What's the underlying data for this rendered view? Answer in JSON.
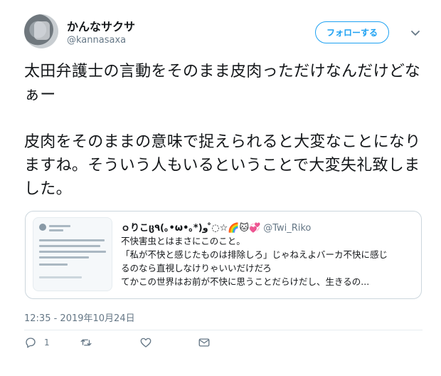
{
  "user": {
    "name": "かんなサクサ",
    "handle": "@kannasaxa",
    "follow_label": "フォローする"
  },
  "tweet": {
    "text": "太田弁護士の言動をそのまま皮肉っただけなんだけどなぁー\n\n皮肉をそのままの意味で捉えられると大変なことになりますね。そういう人もいるということで大変失礼致しました。",
    "timestamp": "12:35 - 2019年10月24日"
  },
  "quoted": {
    "name": "ｏりこც٩(｡•ω•｡*)و ◌̊☆🌈🐱💞",
    "handle": "@Twi_Riko",
    "lines": [
      "不快害虫とはまさにこのこと。",
      "「私が不快と感じたものは排除しろ」じゃねえよバーカ不快に感じ",
      "るのなら直視しなけりゃいいだけだろ",
      "てかこの世界はお前が不快に思うことだらけだし、生きるの..."
    ]
  },
  "actions": {
    "reply_count": "1"
  },
  "icons": {
    "reply": "reply-icon",
    "retweet": "retweet-icon",
    "like": "heart-icon",
    "dm": "envelope-icon",
    "more": "chevron-down-icon"
  },
  "colors": {
    "accent": "#1da1f2",
    "muted": "#657786",
    "border": "#ccd6dd"
  }
}
